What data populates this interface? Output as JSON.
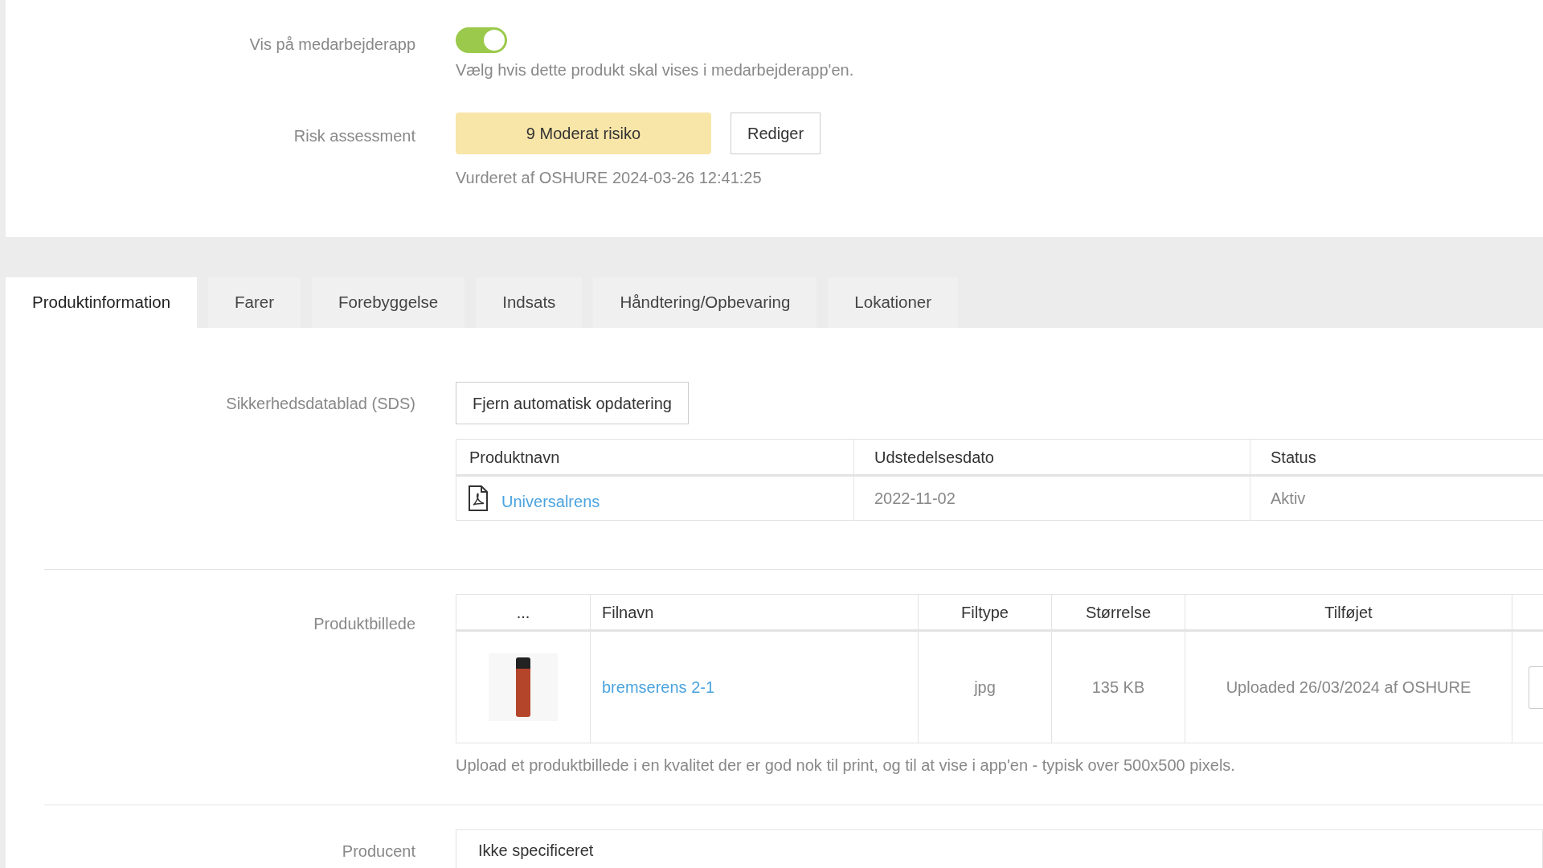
{
  "settings": [
    {
      "kind": "toggle",
      "label": "Vis på medarbejderapp",
      "on": true,
      "help": "Vælg hvis dette produkt skal vises i medarbejderapp'en."
    },
    {
      "kind": "risk",
      "label": "Risk assessment",
      "badge": "9 Moderat risiko",
      "color": "#f8e5a8",
      "button": "Rediger",
      "help": "Vurderet af OSHURE 2024-03-26 12:41:25"
    }
  ],
  "tabs": [
    {
      "label": "Produktinformation",
      "selected": true
    },
    {
      "label": "Farer",
      "selected": false
    },
    {
      "label": "Forebyggelse",
      "selected": false
    },
    {
      "label": "Indsats",
      "selected": false
    },
    {
      "label": "Håndtering/Opbevaring",
      "selected": false
    },
    {
      "label": "Lokationer",
      "selected": false
    }
  ],
  "sds": {
    "label": "Sikkerhedsdatablad (SDS)",
    "button": "Fjern automatisk opdatering",
    "columns": [
      "Produktnavn",
      "Udstedelsesdato",
      "Status"
    ],
    "rows": [
      {
        "name": "Universalrens",
        "date": "2022-11-02",
        "status": "Aktiv"
      }
    ]
  },
  "product_image": {
    "label": "Produktbillede",
    "columns": [
      "...",
      "Filnavn",
      "Filtype",
      "Størrelse",
      "Tilføjet"
    ],
    "rows": [
      {
        "filename": "bremserens 2-1",
        "filetype": "jpg",
        "size": "135 KB",
        "added": "Uploaded 26/03/2024 af OSHURE"
      }
    ],
    "help": "Upload et produktbillede i en kvalitet der er god nok til print, og til at vise i app'en - typisk over 500x500 pixels."
  },
  "producer": {
    "label": "Producent",
    "value": "Ikke specificeret"
  }
}
